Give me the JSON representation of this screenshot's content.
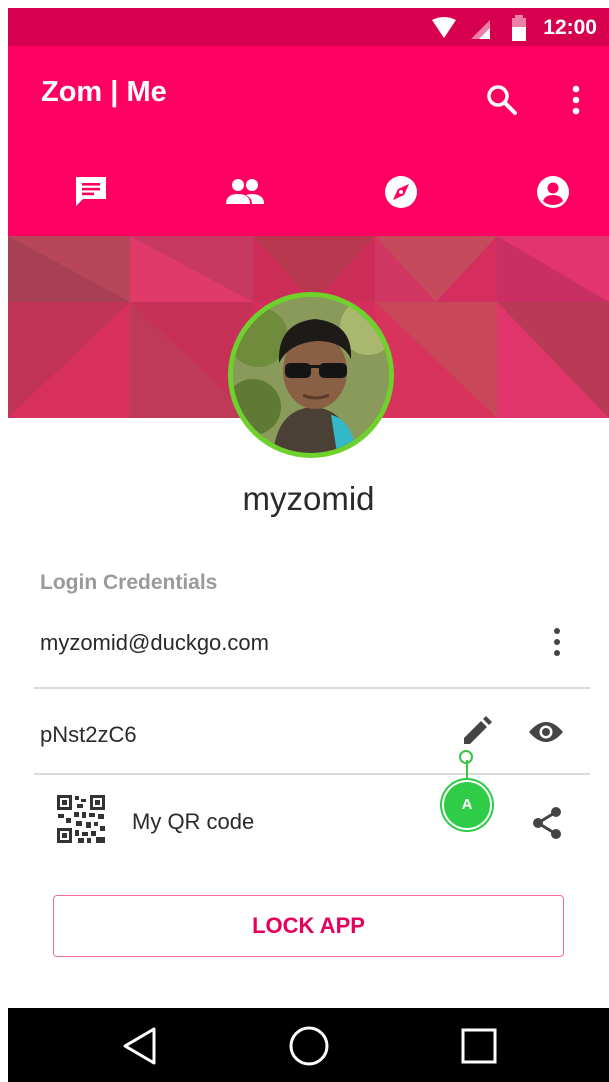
{
  "status_bar": {
    "time": "12:00"
  },
  "app_bar": {
    "title": "Zom | Me",
    "actions": [
      "search-icon",
      "more-vert-icon"
    ],
    "color": "#ff0062"
  },
  "tabs": [
    {
      "name": "chat",
      "icon": "chat-icon",
      "selected": false
    },
    {
      "name": "contacts",
      "icon": "people-icon",
      "selected": false
    },
    {
      "name": "discover",
      "icon": "compass-icon",
      "selected": false
    },
    {
      "name": "me",
      "icon": "account-icon",
      "selected": true
    }
  ],
  "profile": {
    "username": "myzomid",
    "avatar_border_color": "#6fd12b"
  },
  "credentials": {
    "section_label": "Login Credentials",
    "email": "myzomid@duckgo.com",
    "password": "pNst2zC6",
    "qr_label": "My QR code"
  },
  "annotation": {
    "badge_label": "A"
  },
  "lock_button": {
    "label": "LOCK APP"
  }
}
